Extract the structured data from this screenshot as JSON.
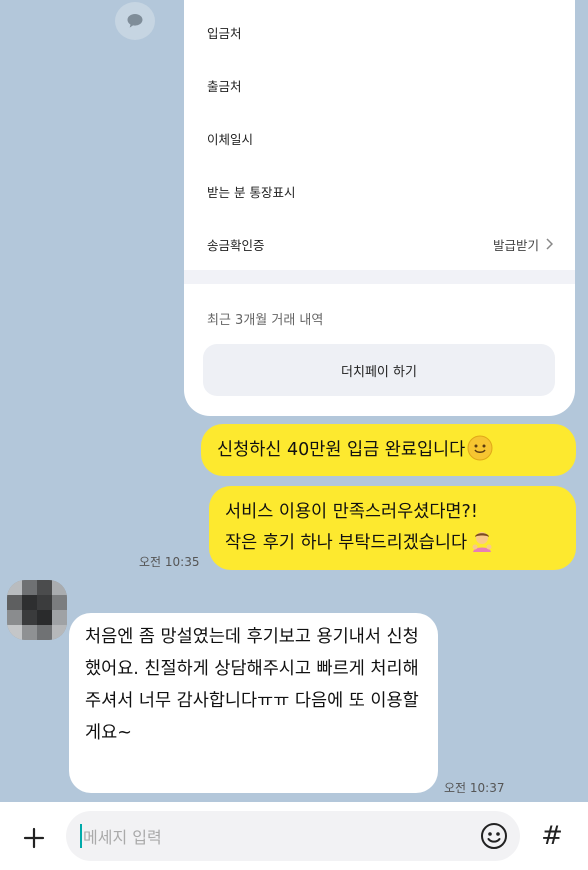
{
  "card": {
    "rows": [
      {
        "label": "입금처",
        "value": ""
      },
      {
        "label": "출금처",
        "value": ""
      },
      {
        "label": "이체일시",
        "value": ""
      },
      {
        "label": "받는 분 통장표시",
        "value": ""
      },
      {
        "label": "송금확인증",
        "value": "발급받기"
      }
    ],
    "recent_label": "최근 3개월 거래 내역",
    "dutch_button": "더치페이 하기"
  },
  "messages": {
    "sent_1": "신청하신 40만원 입금 완료입니다",
    "sent_2_line1": "서비스 이용이 만족스러우셨다면?!",
    "sent_2_line2": "작은 후기 하나 부탁드리겠습니다",
    "sent_time": "오전 10:35",
    "received": "처음엔 좀 망설였는데 후기보고 용기내서 신청했어요. 친절하게 상담해주시고 빠르게 처리해주셔서 너무 감사합니다ㅠㅠ 다음에 또 이용할게요~",
    "received_time": "오전 10:37"
  },
  "input": {
    "placeholder": "메세지 입력",
    "plus_icon": "plus-icon",
    "emoji_icon": "emoji-icon",
    "hash_icon": "#"
  },
  "colors": {
    "background": "#b3c7da",
    "my_bubble": "#fde92f",
    "other_bubble": "#ffffff"
  }
}
